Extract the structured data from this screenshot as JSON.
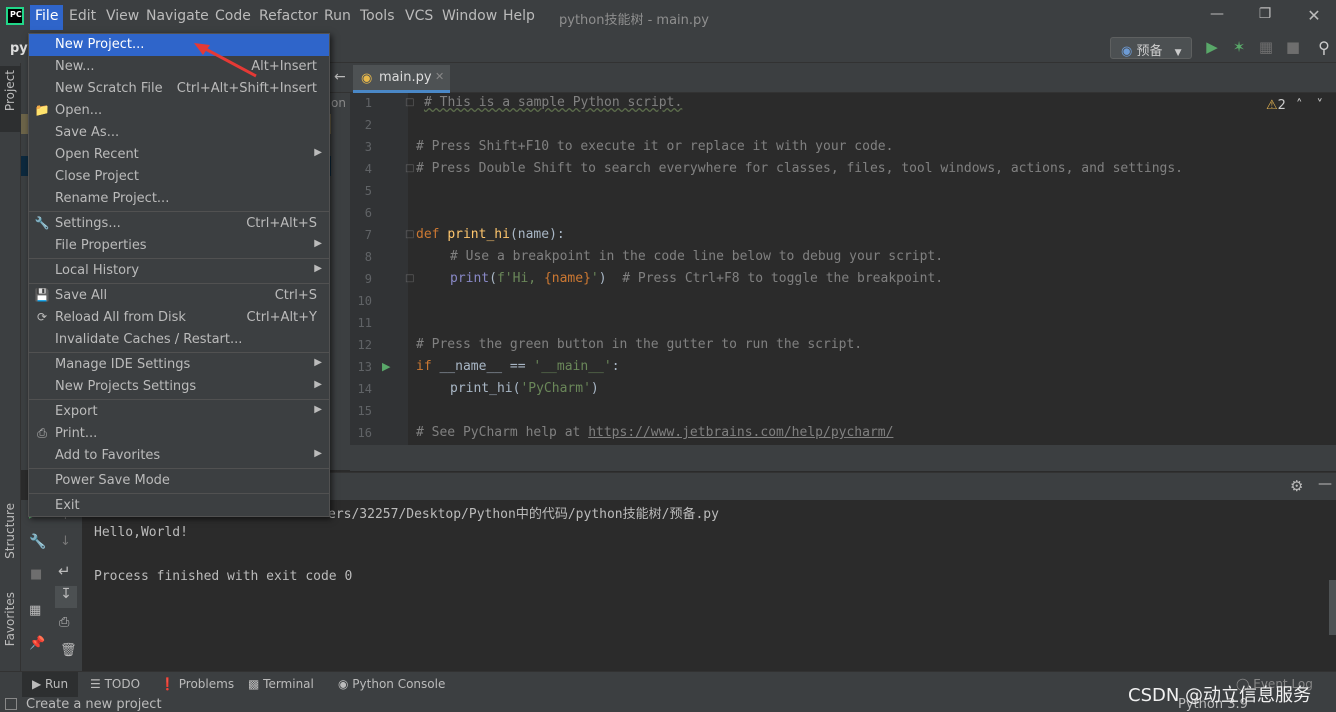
{
  "menubar": {
    "logo": "PC",
    "items": [
      "File",
      "Edit",
      "View",
      "Navigate",
      "Code",
      "Refactor",
      "Run",
      "Tools",
      "VCS",
      "Window",
      "Help"
    ],
    "window_title": "python技能树 - main.py"
  },
  "toolbar": {
    "project_label": "py",
    "run_config": "预备"
  },
  "editor": {
    "tab": "main.py",
    "line_numbers": [
      "1",
      "2",
      "3",
      "4",
      "5",
      "6",
      "7",
      "8",
      "9",
      "10",
      "11",
      "12",
      "13",
      "14",
      "15",
      "16"
    ],
    "warning_count": "2",
    "lines": {
      "l1": "# This is a sample Python script.",
      "l3": "# Press Shift+F10 to execute it or replace it with your code.",
      "l4": "# Press Double Shift to search everywhere for classes, files, tool windows, actions, and settings.",
      "l7_kw": "def ",
      "l7_fn": "print_hi",
      "l7_rest": "(name):",
      "l8": "# Use a breakpoint in the code line below to debug your script.",
      "l9_a": "print",
      "l9_b": "(",
      "l9_c": "f'Hi, ",
      "l9_d": "{name}",
      "l9_e": "'",
      "l9_f": ")  ",
      "l9_g": "# Press Ctrl+F8 to toggle the breakpoint.",
      "l12": "# Press the green button in the gutter to run the script.",
      "l13_kw": "if ",
      "l13_a": "__name__ == ",
      "l13_b": "'__main__'",
      "l13_c": ":",
      "l14_a": "print_hi(",
      "l14_b": "'PyCharm'",
      "l14_c": ")",
      "l16_a": "# See PyCharm help at ",
      "l16_b": "https://www.jetbrains.com/help/pycharm/"
    },
    "hidden_fragment": "on"
  },
  "console": {
    "path_line": "ers/32257/Desktop/Python中的代码/python技能树/预备.py",
    "line2": "Hello,World!",
    "line3": "Process finished with exit code 0"
  },
  "left_strip": {
    "project": "Project",
    "structure": "Structure",
    "favorites": "Favorites"
  },
  "bottom_tabs": [
    "Run",
    "TODO",
    "Problems",
    "Terminal",
    "Python Console"
  ],
  "status": {
    "text": "Create a new project",
    "event_log": "Event Log",
    "right": "Python 3.9"
  },
  "watermark": "CSDN @动立信息服务",
  "file_menu": {
    "new_project": "New Project...",
    "new": "New...",
    "new_sc": "Alt+Insert",
    "scratch": "New Scratch File",
    "scratch_sc": "Ctrl+Alt+Shift+Insert",
    "open": "Open...",
    "save_as": "Save As...",
    "open_recent": "Open Recent",
    "close_project": "Close Project",
    "rename_project": "Rename Project...",
    "settings": "Settings...",
    "settings_sc": "Ctrl+Alt+S",
    "file_properties": "File Properties",
    "local_history": "Local History",
    "save_all": "Save All",
    "save_all_sc": "Ctrl+S",
    "reload": "Reload All from Disk",
    "reload_sc": "Ctrl+Alt+Y",
    "invalidate": "Invalidate Caches / Restart...",
    "manage_ide": "Manage IDE Settings",
    "new_proj_settings": "New Projects Settings",
    "export": "Export",
    "print": "Print...",
    "favorites": "Add to Favorites",
    "power_save": "Power Save Mode",
    "exit": "Exit"
  },
  "colors": {
    "accent": "#2f65ca",
    "annotation_arrow": "#e53935"
  }
}
